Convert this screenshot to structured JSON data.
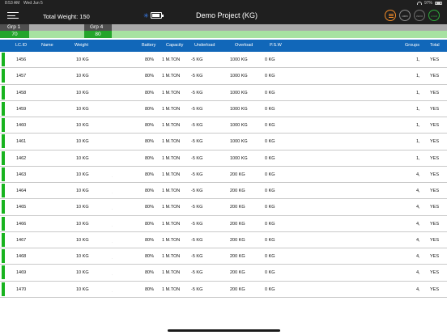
{
  "status_bar": {
    "time": "8:53 AM",
    "date": "Wed Jun 5",
    "battery": "97%"
  },
  "header": {
    "total_weight_label": "Total Weight: 150",
    "project_title": "Demo Project (KG)",
    "buttons": {
      "b2": "100%",
      "b3": "ZERO",
      "b4": "LOAD"
    },
    "accent_colors": {
      "list": "#f28c28",
      "load": "#2eaa3a"
    }
  },
  "groups": [
    {
      "name": "Grp 1",
      "value": "70"
    },
    {
      "name": "Grp 4",
      "value": "80"
    }
  ],
  "table": {
    "columns": {
      "lcid": "LC.ID",
      "name": "Name",
      "weight": "Weight",
      "battery": "Battery",
      "capacity": "Capacity",
      "underload": "Underload",
      "overload": "Overload",
      "psw": "P.S.W",
      "groups": "Groups",
      "total": "Total"
    },
    "rows": [
      {
        "id": "1456",
        "weight": "10 KG",
        "battery": "80%",
        "capacity": "1 M.TON",
        "underload": "-5 KG",
        "overload": "1000 KG",
        "psw": "0 KG",
        "groups": "1,",
        "total": "YES",
        "dot": ""
      },
      {
        "id": "1457",
        "weight": "10 KG",
        "battery": "80%",
        "capacity": "1 M.TON",
        "underload": "-5 KG",
        "overload": "1000 KG",
        "psw": "0 KG",
        "groups": "1,",
        "total": "YES",
        "dot": ""
      },
      {
        "id": "1458",
        "weight": "10 KG",
        "battery": "80%",
        "capacity": "1 M.TON",
        "underload": "-5 KG",
        "overload": "1000 KG",
        "psw": "0 KG",
        "groups": "1,",
        "total": "YES",
        "dot": ""
      },
      {
        "id": "1459",
        "weight": "10 KG",
        "battery": "80%",
        "capacity": "1 M.TON",
        "underload": "-5 KG",
        "overload": "1000 KG",
        "psw": "0 KG",
        "groups": "1,",
        "total": "YES",
        "dot": ""
      },
      {
        "id": "1460",
        "weight": "10 KG",
        "battery": "80%",
        "capacity": "1 M.TON",
        "underload": "-5 KG",
        "overload": "1000 KG",
        "psw": "0 KG",
        "groups": "1,",
        "total": "YES",
        "dot": ""
      },
      {
        "id": "1461",
        "weight": "10 KG",
        "battery": "80%",
        "capacity": "1 M.TON",
        "underload": "-5 KG",
        "overload": "1000 KG",
        "psw": "0 KG",
        "groups": "1,",
        "total": "YES",
        "dot": ""
      },
      {
        "id": "1462",
        "weight": "10 KG",
        "battery": "80%",
        "capacity": "1 M.TON",
        "underload": "-5 KG",
        "overload": "1000 KG",
        "psw": "0 KG",
        "groups": "1,",
        "total": "YES",
        "dot": ""
      },
      {
        "id": "1463",
        "weight": "10 KG",
        "battery": "80%",
        "capacity": "1 M.TON",
        "underload": "-5 KG",
        "overload": "200 KG",
        "psw": "0 KG",
        "groups": "4,",
        "total": "YES",
        "dot": "."
      },
      {
        "id": "1464",
        "weight": "10 KG",
        "battery": "80%",
        "capacity": "1 M.TON",
        "underload": "-5 KG",
        "overload": "200 KG",
        "psw": "0 KG",
        "groups": "4,",
        "total": "YES",
        "dot": "."
      },
      {
        "id": "1465",
        "weight": "10 KG",
        "battery": "80%",
        "capacity": "1 M.TON",
        "underload": "-5 KG",
        "overload": "200 KG",
        "psw": "0 KG",
        "groups": "4,",
        "total": "YES",
        "dot": "."
      },
      {
        "id": "1466",
        "weight": "10 KG",
        "battery": "80%",
        "capacity": "1 M.TON",
        "underload": "-5 KG",
        "overload": "200 KG",
        "psw": "0 KG",
        "groups": "4,",
        "total": "YES",
        "dot": "."
      },
      {
        "id": "1467",
        "weight": "10 KG",
        "battery": "80%",
        "capacity": "1 M.TON",
        "underload": "-5 KG",
        "overload": "200 KG",
        "psw": "0 KG",
        "groups": "4,",
        "total": "YES",
        "dot": "."
      },
      {
        "id": "1468",
        "weight": "10 KG",
        "battery": "80%",
        "capacity": "1 M.TON",
        "underload": "-5 KG",
        "overload": "200 KG",
        "psw": "0 KG",
        "groups": "4,",
        "total": "YES",
        "dot": "."
      },
      {
        "id": "1469",
        "weight": "10 KG",
        "battery": "80%",
        "capacity": "1 M.TON",
        "underload": "-5 KG",
        "overload": "200 KG",
        "psw": "0 KG",
        "groups": "4,",
        "total": "YES",
        "dot": "."
      },
      {
        "id": "1470",
        "weight": "10 KG",
        "battery": "80%",
        "capacity": "1 M.TON",
        "underload": "-5 KG",
        "overload": "200 KG",
        "psw": "0 KG",
        "groups": "4,",
        "total": "YES",
        "dot": "."
      }
    ]
  },
  "colors": {
    "header_bg": "#1f1f1f",
    "table_header": "#1167b9",
    "group_value": "#24a52b",
    "row_indicator": "#18b31e"
  }
}
